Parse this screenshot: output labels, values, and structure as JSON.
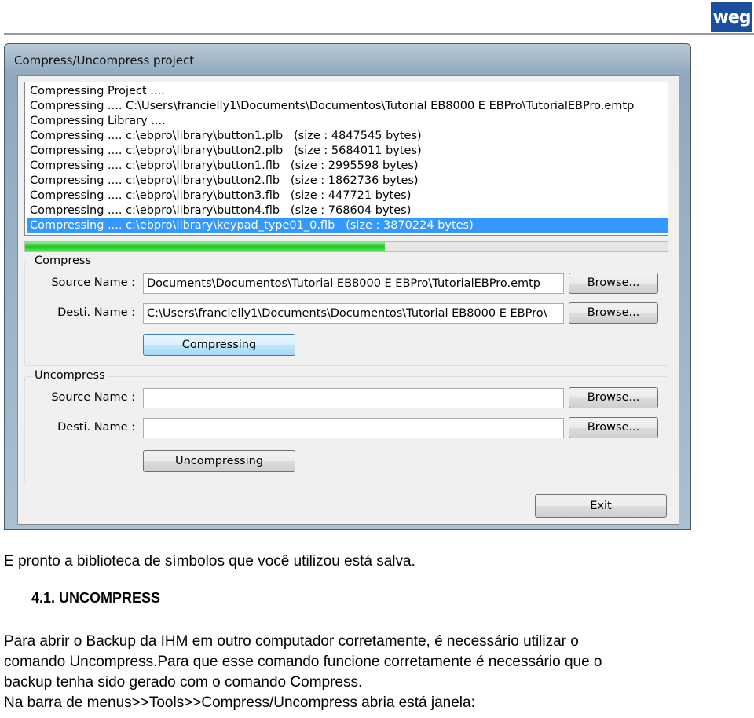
{
  "logo_text": "weg",
  "dialog": {
    "title": "Compress/Uncompress project",
    "log": [
      "Compressing Project ....",
      "Compressing .... C:\\Users\\francielly1\\Documents\\Documentos\\Tutorial EB8000 E EBPro\\TutorialEBPro.emtp",
      "Compressing Library ....",
      "Compressing .... c:\\ebpro\\library\\button1.plb   (size : 4847545 bytes)",
      "Compressing .... c:\\ebpro\\library\\button2.plb   (size : 5684011 bytes)",
      "Compressing .... c:\\ebpro\\library\\button1.flb   (size : 2995598 bytes)",
      "Compressing .... c:\\ebpro\\library\\button2.flb   (size : 1862736 bytes)",
      "Compressing .... c:\\ebpro\\library\\button3.flb   (size : 447721 bytes)",
      "Compressing .... c:\\ebpro\\library\\button4.flb   (size : 768604 bytes)",
      "Compressing .... c:\\ebpro\\library\\keypad_type01_0.flb   (size : 3870224 bytes)"
    ],
    "progress_percent": 56,
    "compress": {
      "label": "Compress",
      "source_label": "Source Name :",
      "source_value": "Documents\\Documentos\\Tutorial EB8000 E EBPro\\TutorialEBPro.emtp",
      "dest_label": "Desti. Name :",
      "dest_value": "C:\\Users\\francielly1\\Documents\\Documentos\\Tutorial EB8000 E EBPro\\",
      "browse": "Browse...",
      "action": "Compressing"
    },
    "uncompress": {
      "label": "Uncompress",
      "source_label": "Source Name :",
      "source_value": "",
      "dest_label": "Desti. Name :",
      "dest_value": "",
      "browse": "Browse...",
      "action": "Uncompressing"
    },
    "exit": "Exit"
  },
  "doc": {
    "p1": "E pronto a biblioteca de símbolos que você utilizou está salva.",
    "heading": "4.1.  UNCOMPRESS",
    "lines": [
      "Para abrir o Backup da IHM em outro computador corretamente, é necessário utilizar o",
      "comando Uncompress.Para que esse comando funcione corretamente é necessário que o",
      "backup tenha sido gerado com o comando Compress.",
      "Na barra de menus>>Tools>>Compress/Uncompress abria está janela:"
    ]
  }
}
